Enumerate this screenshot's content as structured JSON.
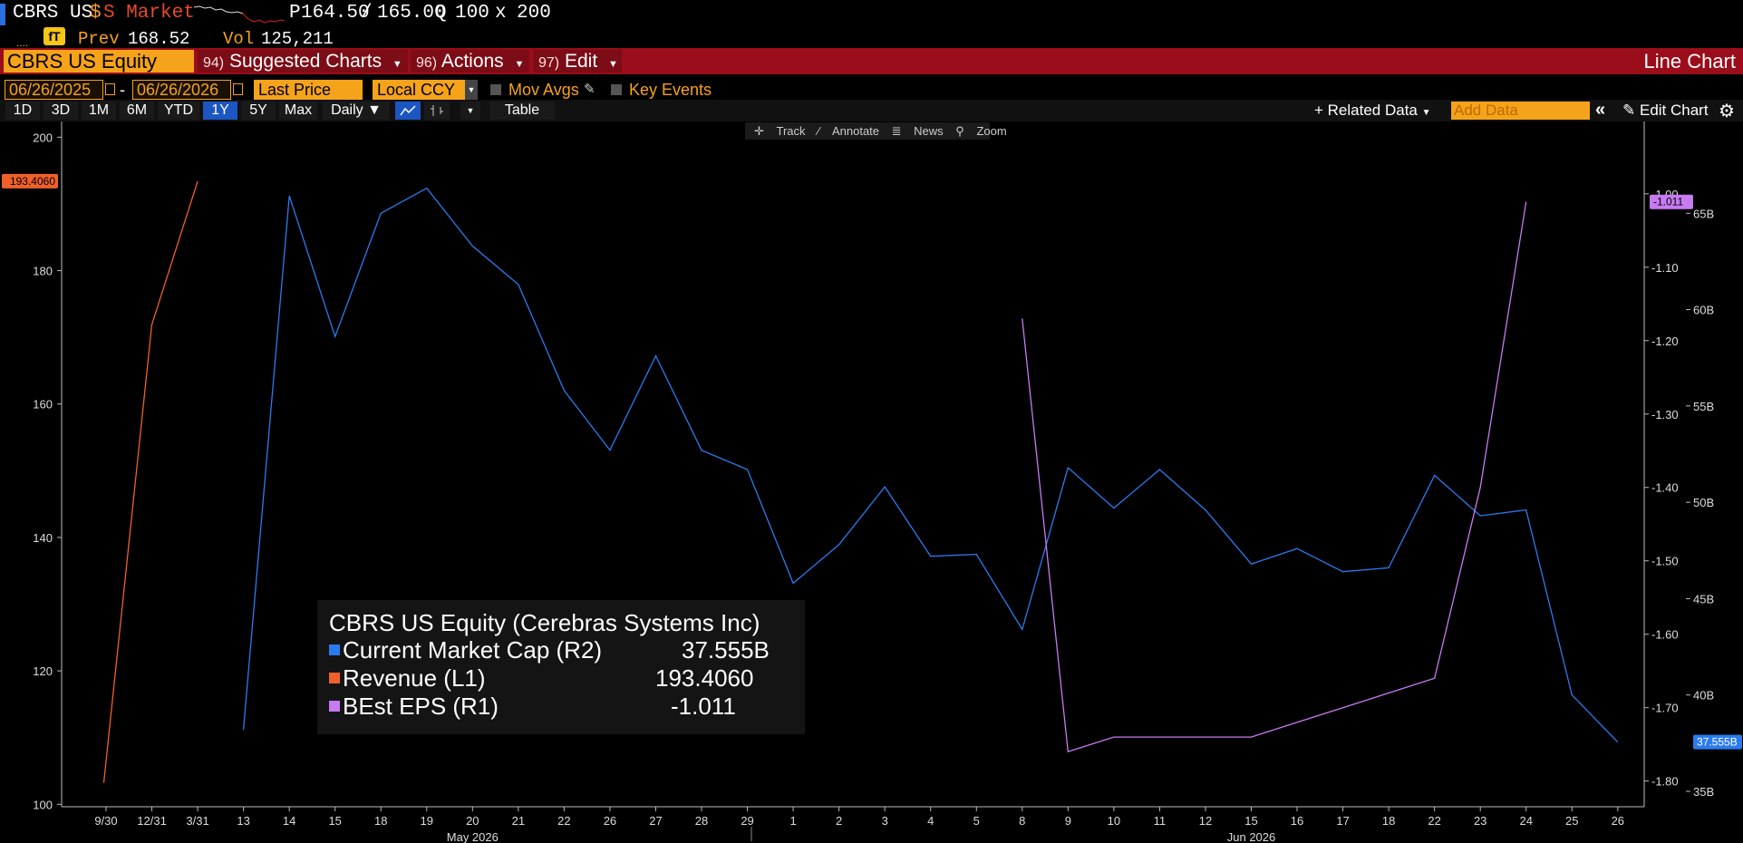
{
  "header": {
    "ticker": "CBRS US",
    "currency_sym": "$",
    "market_label": "S Market",
    "price_prefix": "P",
    "bid": "164.50",
    "sep": "/",
    "ask": "165.00",
    "q_label": "Q",
    "bid_size": "100",
    "x": "x",
    "ask_size": "200",
    "prev_label": "Prev",
    "prev_value": "168.52",
    "vol_label": "Vol",
    "vol_value": "125,211",
    "badge": "fT"
  },
  "menu": {
    "security": "CBRS US Equity",
    "items": [
      {
        "num": "94)",
        "label": "Suggested Charts"
      },
      {
        "num": "96)",
        "label": "Actions"
      },
      {
        "num": "97)",
        "label": "Edit"
      }
    ],
    "chart_type": "Line Chart"
  },
  "controls": {
    "start_date": "06/26/2025",
    "dash": "-",
    "end_date": "06/26/2026",
    "field": "Last Price",
    "currency": "Local CCY",
    "mov_avgs": "Mov Avgs",
    "key_events": "Key Events"
  },
  "periods": {
    "buttons": [
      "1D",
      "3D",
      "1M",
      "6M",
      "YTD",
      "1Y",
      "5Y",
      "Max"
    ],
    "active": "1Y",
    "frequency": "Daily ▼",
    "table": "Table",
    "related": "+ Related Data",
    "add_data_placeholder": "Add Data",
    "edit_chart": "Edit Chart"
  },
  "mini_toolbar": {
    "track": "Track",
    "annotate": "Annotate",
    "news": "News",
    "zoom": "Zoom"
  },
  "legend": {
    "title": "CBRS US Equity (Cerebras Systems Inc)",
    "rows": [
      {
        "name": "Current Market Cap  (R2)",
        "value": "37.555B",
        "color": "#2a7bf0"
      },
      {
        "name": "Revenue  (L1)",
        "value": "193.4060",
        "color": "#f0602a"
      },
      {
        "name": "BEst EPS  (R1)",
        "value": "-1.011",
        "color": "#c77bf0"
      }
    ]
  },
  "chart_data": {
    "type": "line",
    "x_labels": [
      "9/30",
      "12/31",
      "3/31",
      "13",
      "14",
      "15",
      "18",
      "19",
      "20",
      "21",
      "22",
      "26",
      "27",
      "28",
      "29",
      "1",
      "2",
      "3",
      "4",
      "5",
      "8",
      "9",
      "10",
      "11",
      "12",
      "15",
      "16",
      "17",
      "18",
      "22",
      "23",
      "24",
      "25",
      "26"
    ],
    "month_labels": [
      {
        "label": "May 2026",
        "index": 8
      },
      {
        "label": "Jun 2026",
        "index": 25
      }
    ],
    "left_axis": {
      "ticks": [
        100,
        120,
        140,
        160,
        180,
        200
      ],
      "range": [
        98,
        201
      ]
    },
    "right1_axis": {
      "ticks": [
        "-1.00",
        "-1.10",
        "-1.20",
        "-1.30",
        "-1.40",
        "-1.50",
        "-1.60",
        "-1.70",
        "-1.80"
      ],
      "range": [
        -1.835,
        -0.915
      ]
    },
    "right2_axis": {
      "ticks": [
        "65B",
        "60B",
        "55B",
        "50B",
        "45B",
        "40B",
        "35B"
      ],
      "range": [
        34.2,
        69.2
      ]
    },
    "badges": {
      "left": "193.4060",
      "right1": "-1.011",
      "right2": "37.555B"
    },
    "series": [
      {
        "name": "Revenue",
        "axis": "left",
        "color": "#f0602a",
        "x": [
          -0.05,
          1,
          2
        ],
        "values": [
          103.2,
          171.9,
          193.4
        ]
      },
      {
        "name": "Current Market Cap",
        "axis": "right2",
        "color": "#2a7bf0",
        "x": [
          3,
          4,
          5,
          6,
          7,
          8,
          9,
          10,
          11,
          12,
          13,
          14,
          15,
          16,
          17,
          18,
          19,
          20,
          21,
          22,
          23,
          24,
          25,
          26,
          27,
          28,
          29,
          30,
          31,
          32,
          33
        ],
        "values": [
          38.2,
          65.9,
          58.6,
          65.0,
          66.3,
          63.3,
          61.3,
          55.8,
          52.7,
          57.6,
          52.7,
          51.7,
          45.8,
          47.8,
          50.8,
          47.2,
          47.3,
          43.4,
          51.8,
          49.7,
          51.7,
          49.6,
          46.8,
          47.6,
          46.4,
          46.6,
          51.4,
          49.3,
          49.6,
          40.0,
          37.555
        ]
      },
      {
        "name": "BEst EPS",
        "axis": "right1",
        "color": "#c77bf0",
        "x": [
          20,
          21,
          22,
          23,
          24,
          25,
          26,
          27,
          28,
          29,
          30,
          31
        ],
        "values": [
          -1.17,
          -1.76,
          -1.74,
          -1.74,
          -1.74,
          -1.74,
          -1.72,
          -1.7,
          -1.68,
          -1.66,
          -1.4,
          -1.011
        ]
      }
    ]
  }
}
